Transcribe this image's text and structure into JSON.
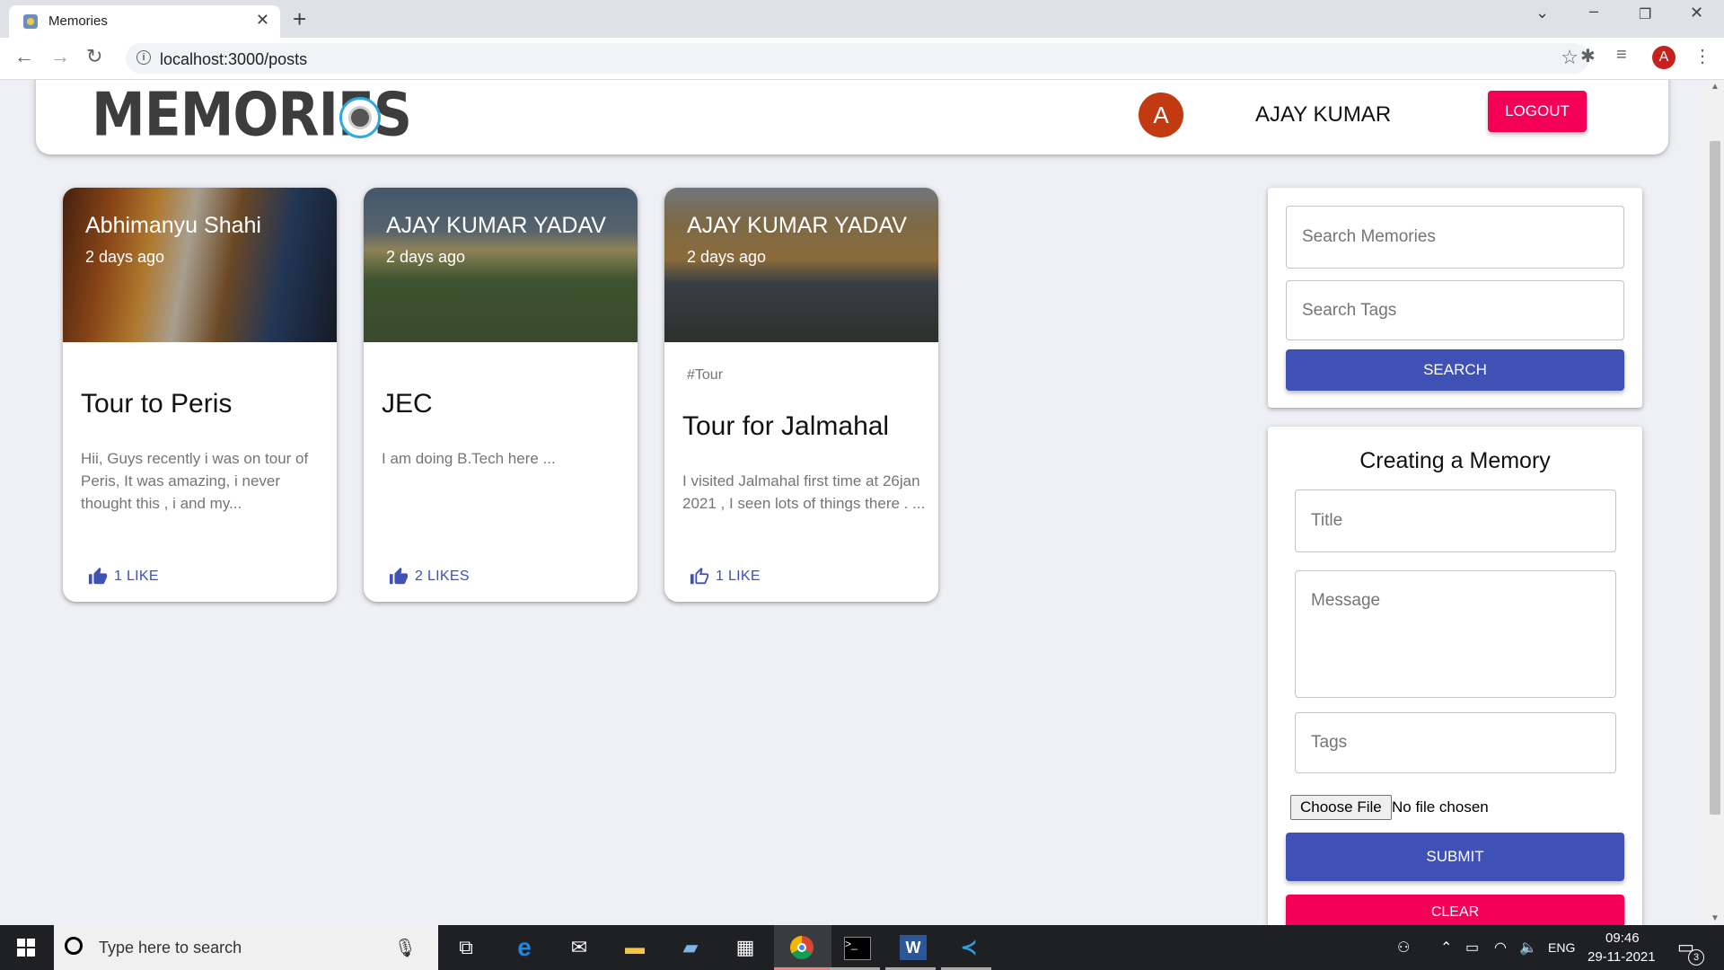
{
  "browser": {
    "tab_title": "Memories",
    "url": "localhost:3000/posts",
    "profile_initial": "A"
  },
  "appbar": {
    "logo_text": "MEMORIES",
    "avatar_initial": "A",
    "user_name": "AJAY KUMAR",
    "logout_label": "LOGOUT"
  },
  "posts": [
    {
      "author": "Abhimanyu Shahi",
      "time": "2 days ago",
      "tags": "",
      "title": "Tour to Peris",
      "message": "Hii, Guys recently i was on tour of Peris, It was amazing, i never thought this , i and my...",
      "likes": "1 LIKE"
    },
    {
      "author": "AJAY KUMAR YADAV",
      "time": "2 days ago",
      "tags": "",
      "title": "JEC",
      "message": "I am doing B.Tech here ...",
      "likes": "2 LIKES"
    },
    {
      "author": "AJAY KUMAR YADAV",
      "time": "2 days ago",
      "tags": "#Tour",
      "title": "Tour for Jalmahal",
      "message": "I visited Jalmahal first time at 26jan 2021 , I seen lots of things there . ...",
      "likes": "1 LIKE"
    }
  ],
  "search": {
    "memories_placeholder": "Search Memories",
    "tags_placeholder": "Search Tags",
    "button_label": "SEARCH"
  },
  "form": {
    "title": "Creating a Memory",
    "title_placeholder": "Title",
    "message_placeholder": "Message",
    "tags_placeholder": "Tags",
    "file_button": "Choose File",
    "file_status": "No file chosen",
    "submit_label": "SUBMIT",
    "clear_label": "CLEAR"
  },
  "taskbar": {
    "search_placeholder": "Type here to search",
    "language": "ENG",
    "time": "09:46",
    "date": "29-11-2021",
    "notification_count": "3"
  },
  "colors": {
    "primary": "#3f51b5",
    "secondary": "#f50057",
    "avatar": "#c23a11"
  }
}
